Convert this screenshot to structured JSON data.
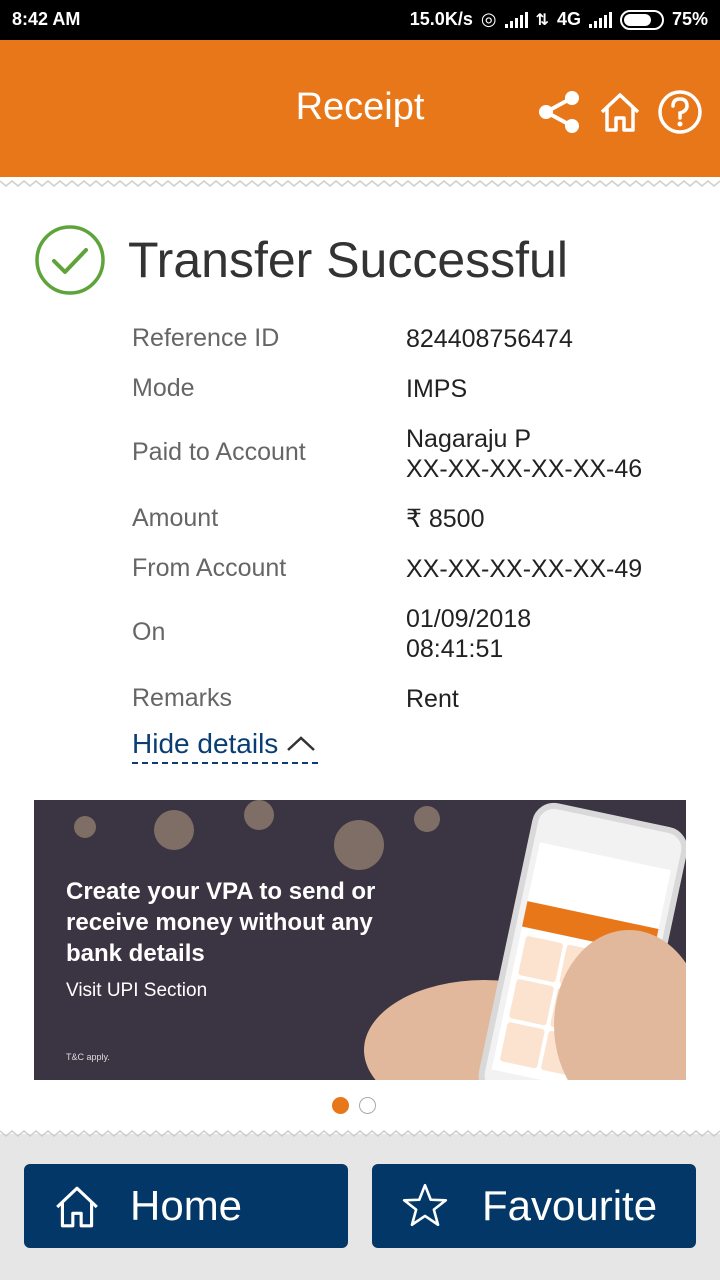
{
  "status_bar": {
    "time": "8:42 AM",
    "net_speed": "15.0K/s",
    "network": "4G",
    "battery": "75%",
    "battery_level": 0.75
  },
  "header": {
    "title": "Receipt",
    "icons": [
      "share-icon",
      "home-icon",
      "help-icon"
    ]
  },
  "receipt": {
    "status_title": "Transfer Successful",
    "rows": [
      {
        "label": "Reference ID",
        "value": "824408756474"
      },
      {
        "label": "Mode",
        "value": "IMPS"
      },
      {
        "label": "Paid to Account",
        "value": "Nagaraju P",
        "value2": "XX-XX-XX-XX-XX-46"
      },
      {
        "label": "Amount",
        "value": "₹ 8500"
      },
      {
        "label": "From Account",
        "value": "XX-XX-XX-XX-XX-49"
      },
      {
        "label": "On",
        "value": "01/09/2018",
        "value2": "08:41:51"
      },
      {
        "label": "Remarks",
        "value": "Rent"
      }
    ],
    "hide_details": "Hide details"
  },
  "banner": {
    "headline": "Create your VPA to send or receive money without any bank details",
    "sub": "Visit UPI Section",
    "tc": "T&C apply.",
    "page_count": 2,
    "active_page": 1
  },
  "footer": {
    "home_label": "Home",
    "favourite_label": "Favourite"
  },
  "colors": {
    "header": "#e8771a",
    "button": "#033767",
    "success": "#5ea43b",
    "link": "#0b3d75"
  }
}
